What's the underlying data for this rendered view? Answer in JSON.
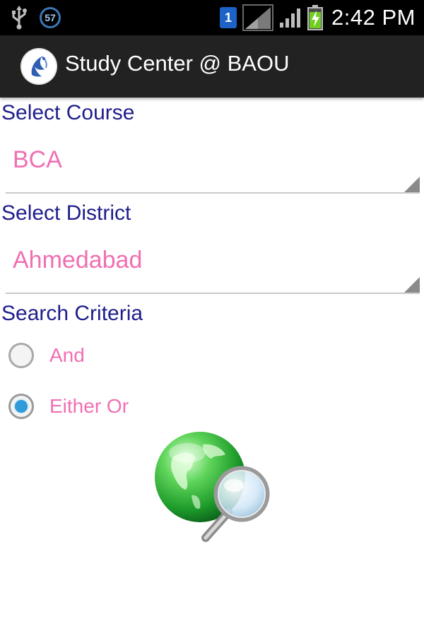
{
  "status_bar": {
    "notification_count": "57",
    "sim_slot": "1",
    "time": "2:42 PM",
    "icons": [
      "usb-icon",
      "notification-badge-icon",
      "sim-icon",
      "no-signal-icon",
      "signal-icon",
      "battery-charging-icon"
    ]
  },
  "action_bar": {
    "title": "Study Center @ BAOU",
    "logo_icon": "baou-logo-icon"
  },
  "form": {
    "course_label": "Select Course",
    "course_value": "BCA",
    "district_label": "Select District",
    "district_value": "Ahmedabad",
    "criteria_label": "Search Criteria",
    "criteria_options": [
      {
        "label": "And",
        "checked": false
      },
      {
        "label": "Either Or",
        "checked": true
      }
    ],
    "search_icon": "globe-search-icon"
  },
  "colors": {
    "label": "#1e1e8c",
    "value": "#f06fb2",
    "radio_checked": "#2f9bd9",
    "action_bar": "#222222"
  }
}
